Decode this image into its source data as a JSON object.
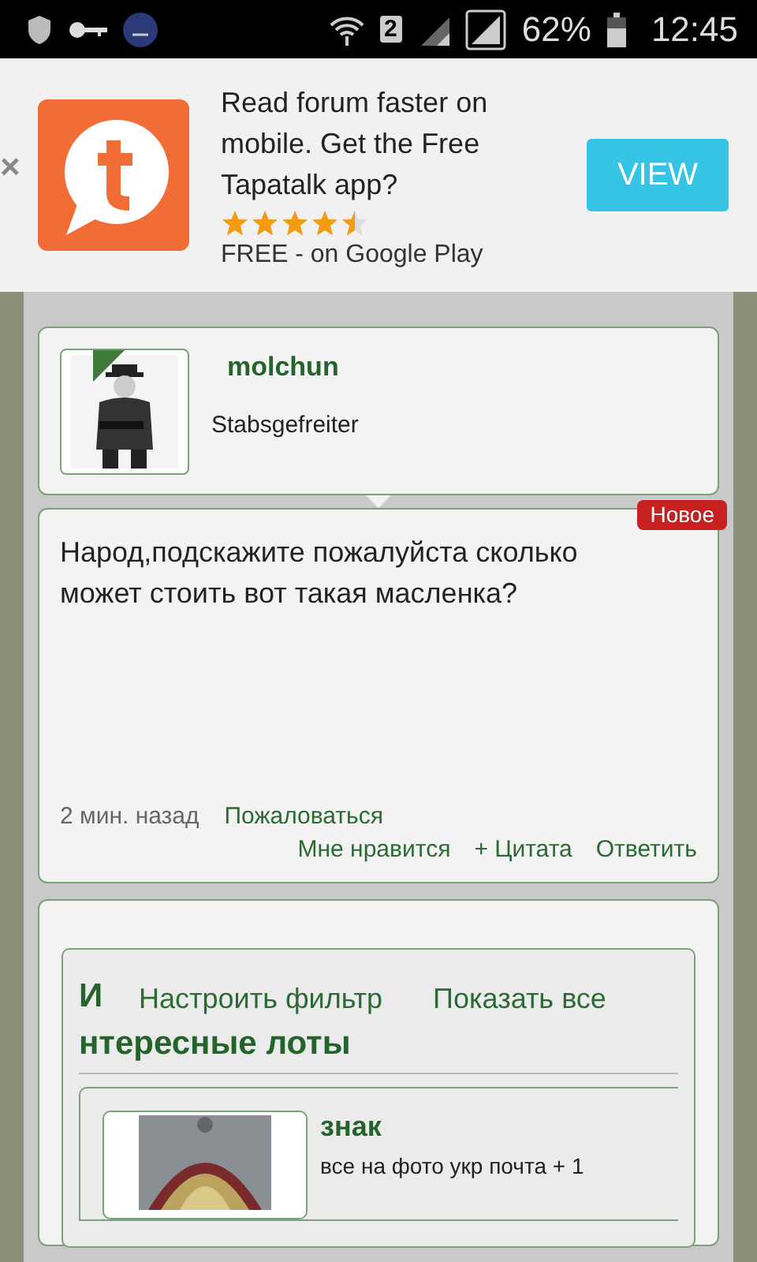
{
  "status_bar": {
    "sim": "2",
    "battery": "62%",
    "time": "12:45"
  },
  "ad": {
    "close": "×",
    "text": "Read forum faster on mobile. Get the Free Tapatalk app?",
    "stars": 4.5,
    "store": "FREE - on Google Play",
    "button": "VIEW"
  },
  "post": {
    "author": "molchun",
    "rank": "Stabsgefreiter",
    "badge": "Новое",
    "body": "Народ,подскажите пожалуйста сколько может стоить вот такая масленка?",
    "time": "2 мин. назад",
    "report": "Пожаловаться",
    "actions": [
      "Мне нравится",
      "+ Цитата",
      "Ответить"
    ]
  },
  "lots": {
    "heading_start": "И",
    "heading_rest": "нтересные лоты",
    "links": [
      "Настроить фильтр",
      "Показать все"
    ],
    "items": [
      {
        "title": "знак",
        "text": "все на фото укр почта + 1"
      }
    ]
  }
}
